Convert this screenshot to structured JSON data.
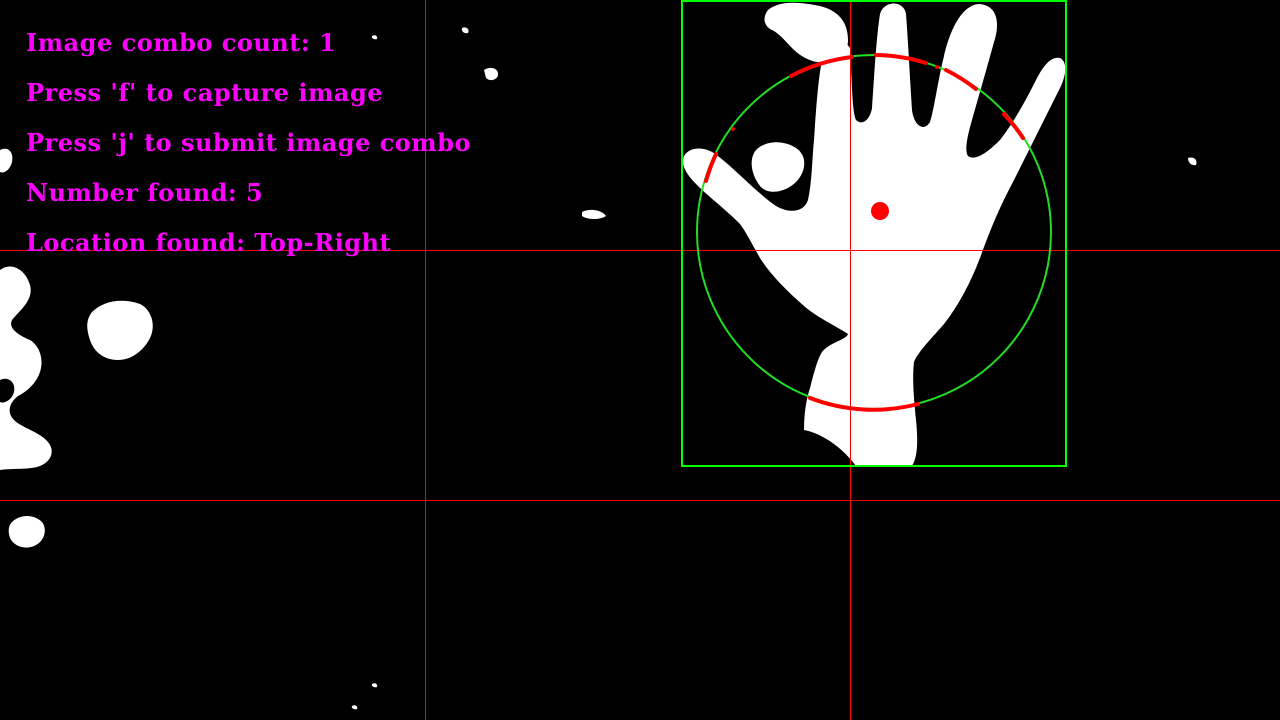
{
  "overlay": {
    "combo_count": "Image combo count: 1",
    "capture_hint": "Press 'f' to capture image",
    "submit_hint": "Press 'j' to submit image combo",
    "number_found": "Number found: 5",
    "location_found": "Location found: Top-Right"
  },
  "colors": {
    "text": "#ff00ff",
    "grid_lines": "#ff0000",
    "bounding_box": "#00ff00",
    "enclosing_circle": "#22dd22",
    "finger_arcs": "#ff0000",
    "palm_center": "#ff0000",
    "mask_foreground": "#ffffff",
    "background": "#000000"
  },
  "detection": {
    "fingers": 5,
    "location": "Top-Right"
  }
}
